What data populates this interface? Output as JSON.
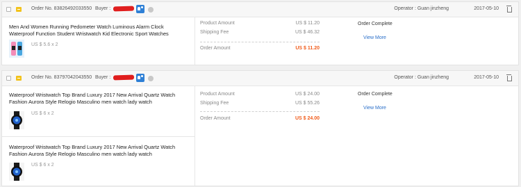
{
  "orders": [
    {
      "order_no": "Order No. 83826492033550",
      "buyer_label": "Buyer :",
      "operator": "Operator : Guan jinzheng",
      "date": "2017-05-10",
      "products": [
        {
          "title": "Men And Women Running Pedometer Watch Luminous Alarm Clock Waterproof Function Student Wristwatch Kid Electronic Sport Watches",
          "price_qty": "US $ 5.6 x 2",
          "thumb_icon": "pink-blue-kids-watch-image"
        }
      ],
      "amounts": {
        "product_amount_label": "Product Amount",
        "product_amount": "US $ 11.20",
        "shipping_fee_label": "Shipping Fee",
        "shipping_fee": "US $ 46.32",
        "order_amount_label": "Order Amount",
        "order_amount": "US $ 11.20"
      },
      "status": "Order Complete",
      "view_more": "View More"
    },
    {
      "order_no": "Order No. 83797042043550",
      "buyer_label": "Buyer :",
      "operator": "Operator : Guan jinzheng",
      "date": "2017-05-10",
      "products": [
        {
          "title": "Waterproof Wristwatch Top Brand Luxury 2017 New Arrival Quartz Watch Fashion Aurora Style Relogio Masculino men watch lady watch",
          "price_qty": "US $ 6 x 2",
          "thumb_icon": "black-blue-quartz-watch-image"
        },
        {
          "title": "Waterproof Wristwatch Top Brand Luxury 2017 New Arrival Quartz Watch Fashion Aurora Style Relogio Masculino men watch lady watch",
          "price_qty": "US $ 6 x 2",
          "thumb_icon": "black-blue-quartz-watch-image"
        }
      ],
      "amounts": {
        "product_amount_label": "Product Amount",
        "product_amount": "US $ 24.00",
        "shipping_fee_label": "Shipping Fee",
        "shipping_fee": "US $ 55.26",
        "order_amount_label": "Order Amount",
        "order_amount": "US $ 24.00"
      },
      "status": "Order Complete",
      "view_more": "View More"
    }
  ],
  "colors": {
    "accent_orange": "#f15b1a",
    "link_blue": "#2a6fc9",
    "redact_red": "#e01e1e",
    "flag_yellow": "#f2c21b",
    "message_blue": "#2f80d6"
  }
}
